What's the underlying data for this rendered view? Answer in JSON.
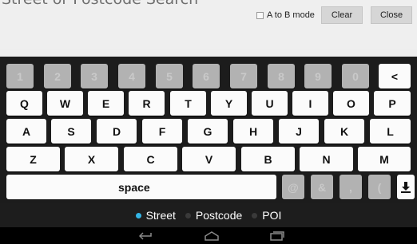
{
  "title": "Street or Postcode Search",
  "ab_mode_label": "A to B mode",
  "ab_mode_checked": false,
  "clear_label": "Clear",
  "close_label": "Close",
  "number_row": [
    "1",
    "2",
    "3",
    "4",
    "5",
    "6",
    "7",
    "8",
    "9",
    "0"
  ],
  "backspace": "<",
  "row1": [
    "Q",
    "W",
    "E",
    "R",
    "T",
    "Y",
    "U",
    "I",
    "O",
    "P"
  ],
  "row2": [
    "A",
    "S",
    "D",
    "F",
    "G",
    "H",
    "J",
    "K",
    "L"
  ],
  "row3": [
    "Z",
    "X",
    "C",
    "V",
    "B",
    "N",
    "M"
  ],
  "space_label": "space",
  "symbol_keys": [
    "@",
    "&",
    ",",
    "("
  ],
  "hide_keyboard_icon": "download-arrow-icon",
  "search_modes": [
    {
      "label": "Street",
      "selected": true
    },
    {
      "label": "Postcode",
      "selected": false
    },
    {
      "label": "POI",
      "selected": false
    }
  ],
  "colors": {
    "selected_dot": "#33b5e5",
    "unselected_dot": "#3a3a3a",
    "mode_text": "#ffffff",
    "key_text": "#111111"
  }
}
